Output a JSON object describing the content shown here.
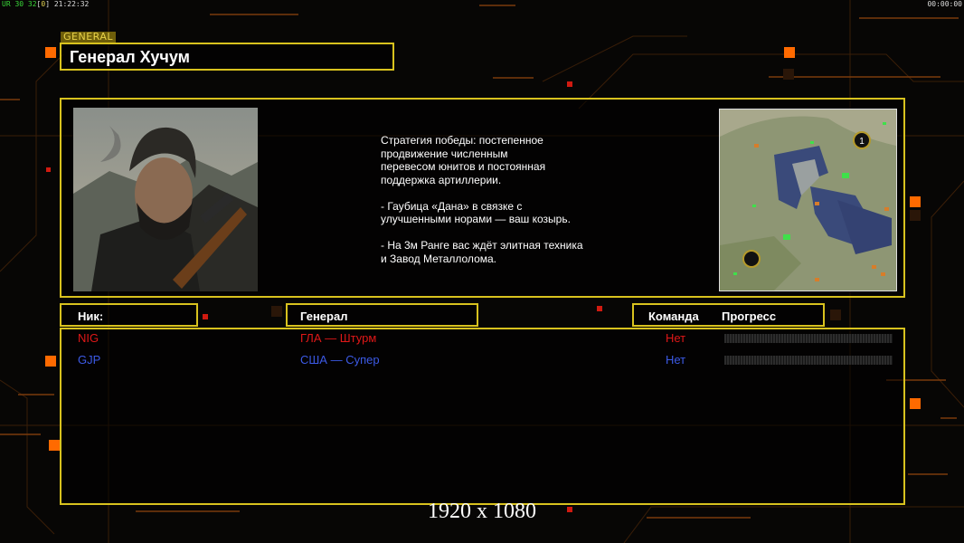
{
  "hud": {
    "left_fps": "UR 30 32",
    "left_bracket": "0",
    "left_time": "21:22:32",
    "right_time": "00:00:00"
  },
  "general": {
    "tag": "GENERAL",
    "name": "Генерал Хучум"
  },
  "description": "Стратегия победы: постепенное\nпродвижение численным\nперевесом юнитов и постоянная\nподдержка артиллерии.\n\n- Гаубица «Дана» в связке с\nулучшенными норами — ваш козырь.\n\n- На 3м Ранге вас ждёт элитная техника\nи Завод Металлолома.",
  "minimap": {
    "marker_label": "1"
  },
  "columns": {
    "nick": "Ник:",
    "general": "Генерал",
    "team": "Команда",
    "progress": "Прогресс"
  },
  "players": [
    {
      "nick": "NIG",
      "general": "ГЛА — Штурм",
      "team": "Нет",
      "color": "#e01818"
    },
    {
      "nick": "GJP",
      "general": "США — Супер",
      "team": "Нет",
      "color": "#3c5ae6"
    }
  ],
  "resolution": "1920 x 1080",
  "colors": {
    "frame": "#d8c21e",
    "accent_orange": "#ff7a00"
  }
}
